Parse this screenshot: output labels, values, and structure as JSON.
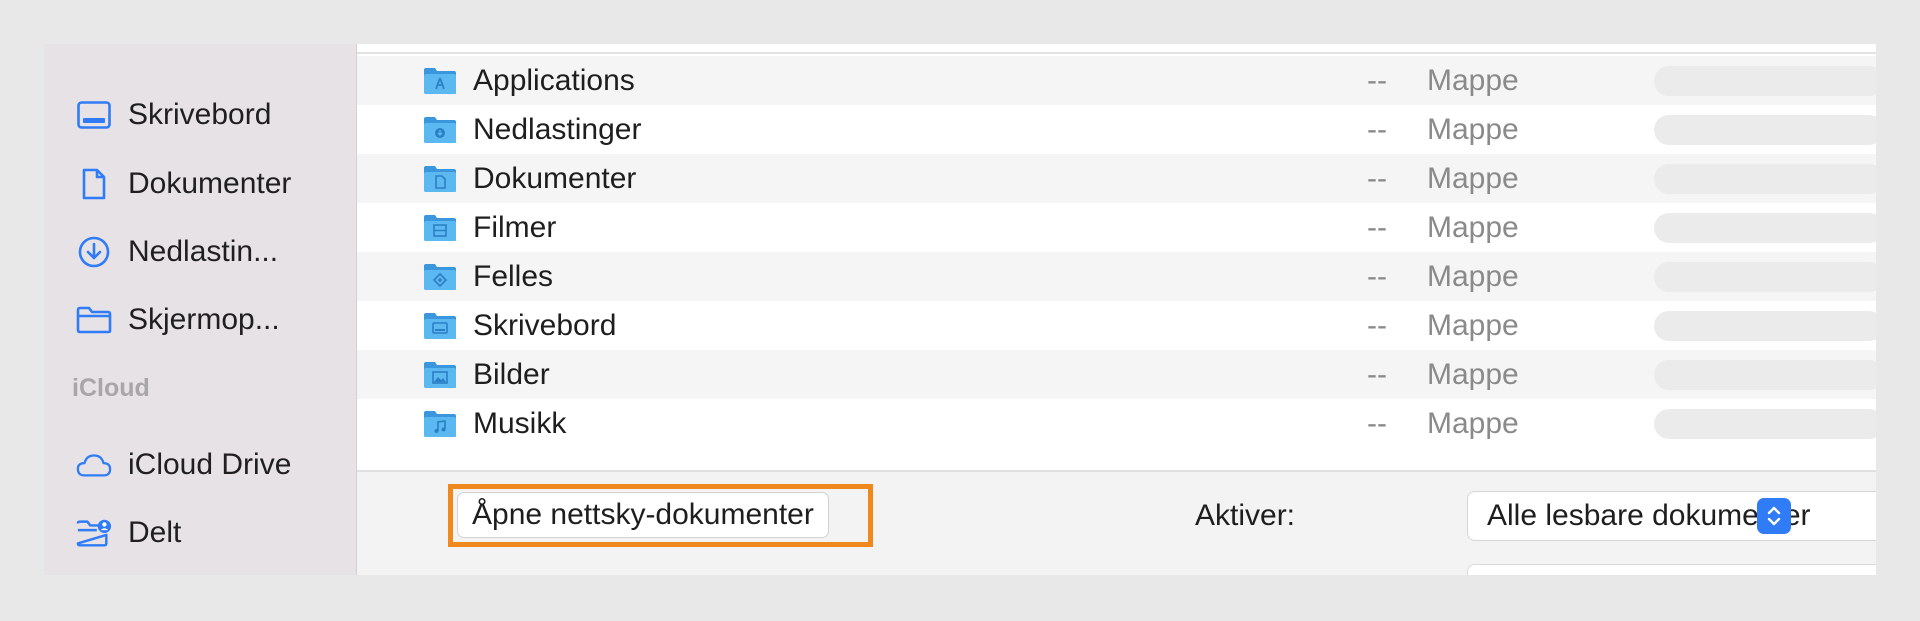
{
  "sidebar": {
    "items": [
      {
        "label": "Skrivebord",
        "icon": "desktop-icon"
      },
      {
        "label": "Dokumenter",
        "icon": "document-icon"
      },
      {
        "label": "Nedlastin...",
        "icon": "download-icon"
      },
      {
        "label": "Skjermop...",
        "icon": "folder-icon"
      }
    ],
    "section_icloud": "iCloud",
    "icloud_items": [
      {
        "label": "iCloud Drive",
        "icon": "cloud-icon"
      },
      {
        "label": "Delt",
        "icon": "shared-folder-icon"
      }
    ]
  },
  "files": [
    {
      "name": "Applications",
      "size": "--",
      "kind": "Mappe",
      "glyph": "applications-icon"
    },
    {
      "name": "Nedlastinger",
      "size": "--",
      "kind": "Mappe",
      "glyph": "downloads-icon"
    },
    {
      "name": "Dokumenter",
      "size": "--",
      "kind": "Mappe",
      "glyph": "documents-icon"
    },
    {
      "name": "Filmer",
      "size": "--",
      "kind": "Mappe",
      "glyph": "movies-icon"
    },
    {
      "name": "Felles",
      "size": "--",
      "kind": "Mappe",
      "glyph": "shared-icon"
    },
    {
      "name": "Skrivebord",
      "size": "--",
      "kind": "Mappe",
      "glyph": "desktop-icon"
    },
    {
      "name": "Bilder",
      "size": "--",
      "kind": "Mappe",
      "glyph": "pictures-icon"
    },
    {
      "name": "Musikk",
      "size": "--",
      "kind": "Mappe",
      "glyph": "music-icon"
    }
  ],
  "footer": {
    "cloud_button": "Åpne nettsky-dokumenter",
    "enable_label": "Aktiver:",
    "format_value": "Alle lesbare dokumenter"
  },
  "colors": {
    "accent": "#2f7cf6",
    "highlight": "#f0891d",
    "folder": "#4aaae8"
  }
}
